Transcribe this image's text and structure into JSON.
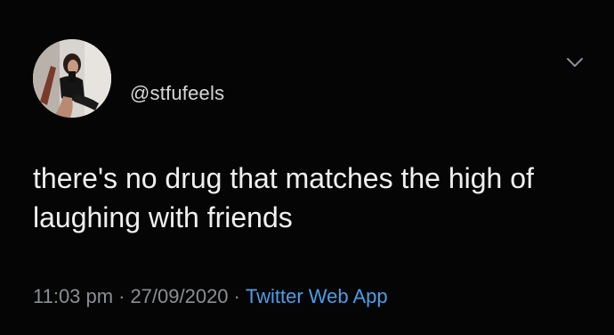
{
  "tweet": {
    "handle": "@stfufeels",
    "text": "there's no drug that matches the high of laughing with friends",
    "time": "11:03 pm",
    "date": "27/09/2020",
    "separator": "·",
    "source": "Twitter Web App",
    "avatar_icon": "profile-photo",
    "menu_icon": "chevron-down-icon"
  },
  "colors": {
    "background": "#050505",
    "text": "#f0f0f0",
    "muted": "#8b8f94",
    "link": "#4a9fe8"
  }
}
